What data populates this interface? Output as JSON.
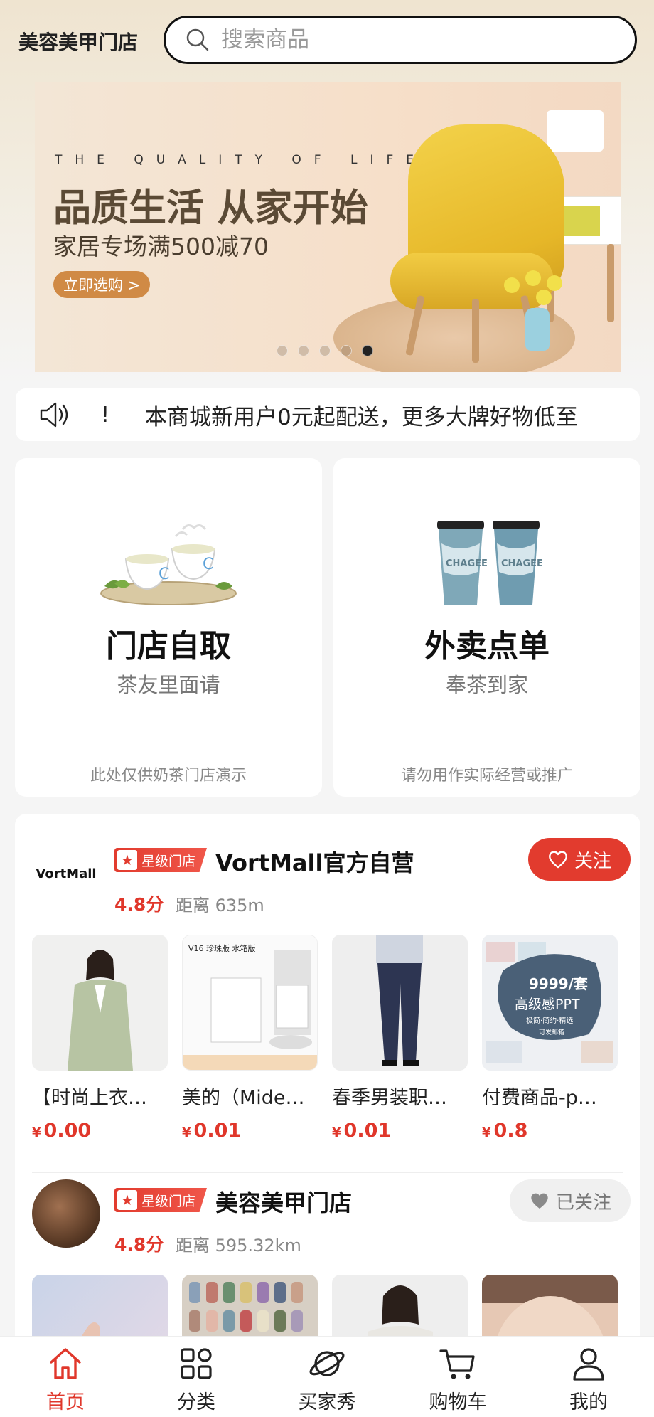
{
  "header": {
    "shop_title": "美容美甲门店",
    "search_placeholder": "搜索商品"
  },
  "banner": {
    "tagline": "THE QUALITY OF LIFE",
    "headline": "品质生活 从家开始",
    "subline": "家居专场满500减70",
    "cta": "立即选购 >",
    "slide_count": 5,
    "active_slide": 5
  },
  "notice": {
    "icon": "speaker-icon",
    "prefix": "!",
    "text": "本商城新用户0元起配送，更多大牌好物低至"
  },
  "order_cards": [
    {
      "title": "门店自取",
      "subtitle": "茶友里面请",
      "note": "此处仅供奶茶门店演示"
    },
    {
      "title": "外卖点单",
      "subtitle": "奉茶到家",
      "note": "请勿用作实际经营或推广"
    }
  ],
  "stores": [
    {
      "logo_text": "VortMall",
      "badge": "星级门店",
      "name": "VortMall官方自营",
      "rating": "4.8分",
      "distance": "距离 635m",
      "follow_label": "关注",
      "followed": false,
      "products": [
        {
          "name": "【时尚上衣…",
          "currency": "¥",
          "price": "0.00"
        },
        {
          "name": "美的（Mide…",
          "currency": "¥",
          "price": "0.01"
        },
        {
          "name": "春季男装职…",
          "currency": "¥",
          "price": "0.01"
        },
        {
          "name": "付费商品-p…",
          "currency": "¥",
          "price": "0.8"
        }
      ]
    },
    {
      "badge": "星级门店",
      "name": "美容美甲门店",
      "rating": "4.8分",
      "distance": "距离 595.32km",
      "follow_label": "已关注",
      "followed": true
    }
  ],
  "product_image_text": {
    "vacuum_tag": "V16 珍珠版 水箱版",
    "ppt_big": "9999/套",
    "ppt_title": "高级感PPT",
    "ppt_sub": "极简·简约·精选",
    "ppt_note": "可发邮箱"
  },
  "tabbar": [
    {
      "label": "首页",
      "icon": "home-icon",
      "active": true
    },
    {
      "label": "分类",
      "icon": "category-icon",
      "active": false
    },
    {
      "label": "买家秀",
      "icon": "planet-icon",
      "active": false
    },
    {
      "label": "购物车",
      "icon": "cart-icon",
      "active": false
    },
    {
      "label": "我的",
      "icon": "user-icon",
      "active": false
    }
  ],
  "colors": {
    "accent": "#e23b2e",
    "price": "#e0372b"
  }
}
